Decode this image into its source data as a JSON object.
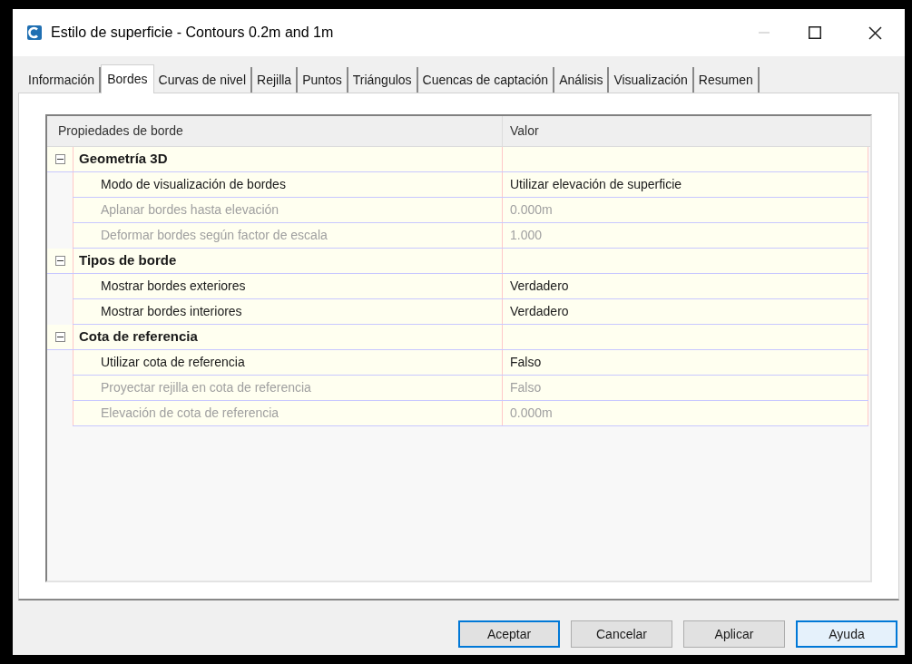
{
  "window": {
    "title": "Estilo de superficie - Contours 0.2m and 1m"
  },
  "tabs": [
    {
      "label": "Información",
      "selected": false
    },
    {
      "label": "Bordes",
      "selected": true
    },
    {
      "label": "Curvas de nivel",
      "selected": false
    },
    {
      "label": "Rejilla",
      "selected": false
    },
    {
      "label": "Puntos",
      "selected": false
    },
    {
      "label": "Triángulos",
      "selected": false
    },
    {
      "label": "Cuencas de captación",
      "selected": false
    },
    {
      "label": "Análisis",
      "selected": false
    },
    {
      "label": "Visualización",
      "selected": false
    },
    {
      "label": "Resumen",
      "selected": false
    }
  ],
  "grid": {
    "columns": [
      "Propiedades de borde",
      "Valor"
    ],
    "groups": [
      {
        "name": "Geometría 3D",
        "expanded": true,
        "properties": [
          {
            "name": "Modo de visualización de bordes",
            "value": "Utilizar elevación de superficie",
            "disabled": false
          },
          {
            "name": "Aplanar bordes hasta elevación",
            "value": "0.000m",
            "disabled": true
          },
          {
            "name": "Deformar bordes según factor de escala",
            "value": "1.000",
            "disabled": true
          }
        ]
      },
      {
        "name": "Tipos de borde",
        "expanded": true,
        "properties": [
          {
            "name": "Mostrar bordes exteriores",
            "value": "Verdadero",
            "disabled": false
          },
          {
            "name": "Mostrar bordes interiores",
            "value": "Verdadero",
            "disabled": false
          }
        ]
      },
      {
        "name": "Cota de referencia",
        "expanded": true,
        "properties": [
          {
            "name": "Utilizar cota de referencia",
            "value": "Falso",
            "disabled": false
          },
          {
            "name": "Proyectar rejilla en cota de referencia",
            "value": "Falso",
            "disabled": true
          },
          {
            "name": "Elevación de cota de referencia",
            "value": "0.000m",
            "disabled": true
          }
        ]
      }
    ]
  },
  "buttons": [
    {
      "label": "Aceptar",
      "default": true,
      "highlighted": false
    },
    {
      "label": "Cancelar",
      "default": false,
      "highlighted": false
    },
    {
      "label": "Aplicar",
      "default": false,
      "highlighted": false
    },
    {
      "label": "Ayuda",
      "default": false,
      "highlighted": true
    }
  ]
}
